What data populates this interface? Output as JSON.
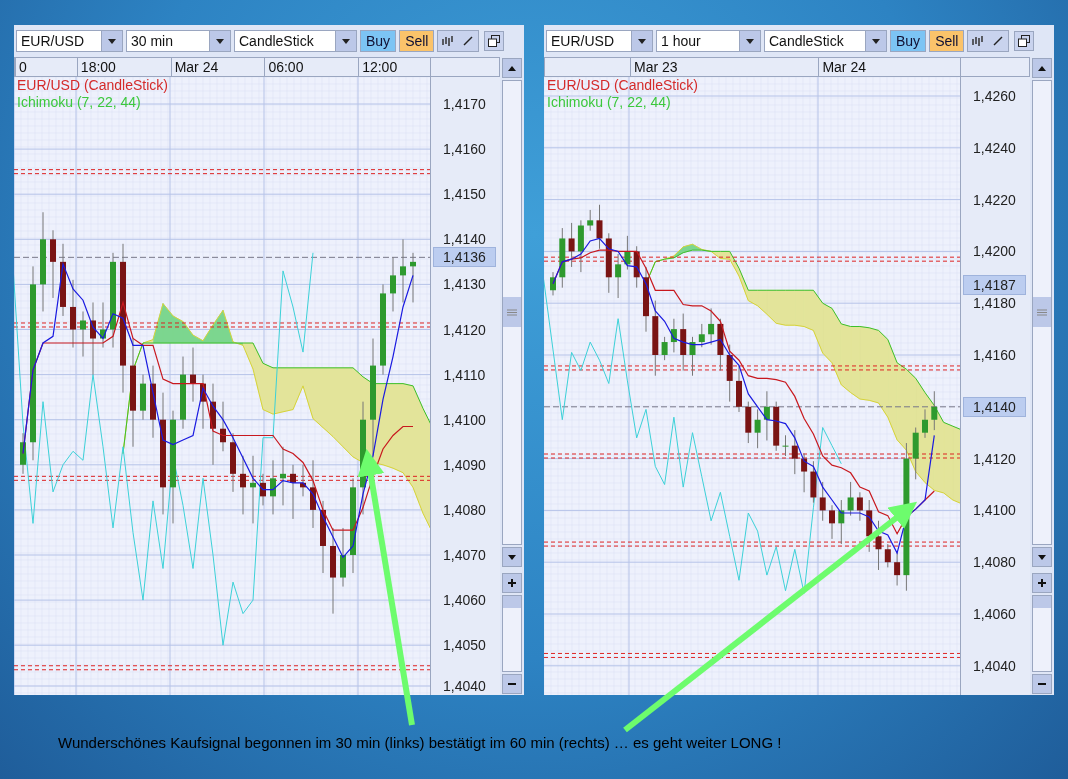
{
  "panels": [
    {
      "toolbar": {
        "symbol": "EUR/USD",
        "interval": "30 min",
        "chart_type": "CandleStick",
        "buy": "Buy",
        "sell": "Sell"
      },
      "time_labels": [
        "0",
        "18:00",
        "Mar 24",
        "06:00",
        "12:00"
      ],
      "legend": [
        {
          "text": "EUR/USD (CandleStick)",
          "color": "#d42a2a"
        },
        {
          "text": "Ichimoku (7, 22, 44)",
          "color": "#3cc83c"
        }
      ],
      "price_labels": [
        {
          "label": "1,4170",
          "highlighted": false
        },
        {
          "label": "1,4160",
          "highlighted": false
        },
        {
          "label": "1,4150",
          "highlighted": false
        },
        {
          "label": "1,4140",
          "highlighted": false
        },
        {
          "label": "1,4136",
          "highlighted": true
        },
        {
          "label": "1,4130",
          "highlighted": false
        },
        {
          "label": "1,4120",
          "highlighted": false
        },
        {
          "label": "1,4110",
          "highlighted": false
        },
        {
          "label": "1,4100",
          "highlighted": false
        },
        {
          "label": "1,4090",
          "highlighted": false
        },
        {
          "label": "1,4080",
          "highlighted": false
        },
        {
          "label": "1,4070",
          "highlighted": false
        },
        {
          "label": "1,4060",
          "highlighted": false
        },
        {
          "label": "1,4050",
          "highlighted": false
        },
        {
          "label": "1,4040",
          "highlighted": false
        }
      ]
    },
    {
      "toolbar": {
        "symbol": "EUR/USD",
        "interval": "1 hour",
        "chart_type": "CandleStick",
        "buy": "Buy",
        "sell": "Sell"
      },
      "time_labels": [
        "Mar 23",
        "Mar 24"
      ],
      "legend": [
        {
          "text": "EUR/USD (CandleStick)",
          "color": "#d42a2a"
        },
        {
          "text": "Ichimoku (7, 22, 44)",
          "color": "#3cc83c"
        }
      ],
      "price_labels": [
        {
          "label": "1,4260",
          "highlighted": false
        },
        {
          "label": "1,4240",
          "highlighted": false
        },
        {
          "label": "1,4220",
          "highlighted": false
        },
        {
          "label": "1,4200",
          "highlighted": false
        },
        {
          "label": "1,4187",
          "highlighted": true
        },
        {
          "label": "1,4180",
          "highlighted": false
        },
        {
          "label": "1,4160",
          "highlighted": false
        },
        {
          "label": "1,4140",
          "highlighted": true
        },
        {
          "label": "1,4120",
          "highlighted": false
        },
        {
          "label": "1,4100",
          "highlighted": false
        },
        {
          "label": "1,4080",
          "highlighted": false
        },
        {
          "label": "1,4060",
          "highlighted": false
        },
        {
          "label": "1,4040",
          "highlighted": false
        }
      ]
    }
  ],
  "caption": "Wunderschönes Kaufsignal begonnen im 30 min (links) bestätigt im 60 min (rechts) … es geht weiter LONG !"
}
